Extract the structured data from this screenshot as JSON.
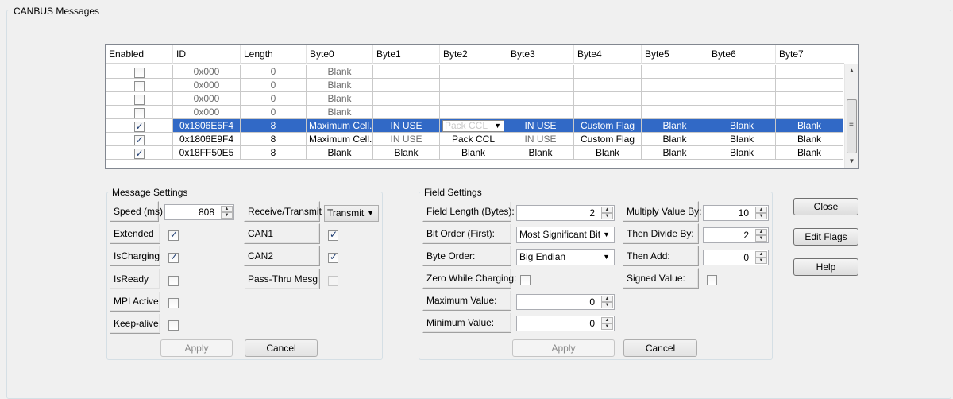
{
  "group_title": "CANBUS Messages",
  "table": {
    "headers": [
      "Enabled",
      "ID",
      "Length",
      "Byte0",
      "Byte1",
      "Byte2",
      "Byte3",
      "Byte4",
      "Byte5",
      "Byte6",
      "Byte7"
    ],
    "rows": [
      {
        "enabled": false,
        "id": "0x000",
        "length": "0",
        "bytes": [
          "Blank",
          "",
          "",
          "",
          "",
          "",
          "",
          ""
        ],
        "state": "dim"
      },
      {
        "enabled": false,
        "id": "0x000",
        "length": "0",
        "bytes": [
          "Blank",
          "",
          "",
          "",
          "",
          "",
          "",
          ""
        ],
        "state": "dim"
      },
      {
        "enabled": false,
        "id": "0x000",
        "length": "0",
        "bytes": [
          "Blank",
          "",
          "",
          "",
          "",
          "",
          "",
          ""
        ],
        "state": "dim"
      },
      {
        "enabled": false,
        "id": "0x000",
        "length": "0",
        "bytes": [
          "Blank",
          "",
          "",
          "",
          "",
          "",
          "",
          ""
        ],
        "state": "dim"
      },
      {
        "enabled": true,
        "id": "0x1806E5F4",
        "length": "8",
        "bytes": [
          "Maximum Cell...",
          "IN USE",
          "Pack CCL",
          "IN USE",
          "Custom Flag",
          "Blank",
          "Blank",
          "Blank"
        ],
        "state": "selected"
      },
      {
        "enabled": true,
        "id": "0x1806E9F4",
        "length": "8",
        "bytes": [
          "Maximum Cell...",
          "IN USE",
          "Pack CCL",
          "IN USE",
          "Custom Flag",
          "Blank",
          "Blank",
          "Blank"
        ],
        "state": "normal"
      },
      {
        "enabled": true,
        "id": "0x18FF50E5",
        "length": "8",
        "bytes": [
          "Blank",
          "Blank",
          "Blank",
          "Blank",
          "Blank",
          "Blank",
          "Blank",
          "Blank"
        ],
        "state": "normal"
      }
    ]
  },
  "message_settings": {
    "title": "Message Settings",
    "speed_label": "Speed (ms)",
    "speed_value": "808",
    "extended_label": "Extended",
    "extended_checked": true,
    "ischarging_label": "IsCharging",
    "ischarging_checked": true,
    "isready_label": "IsReady",
    "isready_checked": false,
    "mpi_active_label": "MPI Active",
    "mpi_active_checked": false,
    "keepalive_label": "Keep-alive",
    "keepalive_checked": false,
    "rx_tx_label": "Receive/Transmit",
    "rx_tx_value": "Transmit",
    "can1_label": "CAN1",
    "can1_checked": true,
    "can2_label": "CAN2",
    "can2_checked": true,
    "passthru_label": "Pass-Thru Mesg",
    "passthru_checked": false,
    "apply_label": "Apply",
    "cancel_label": "Cancel"
  },
  "field_settings": {
    "title": "Field Settings",
    "field_length_label": "Field Length (Bytes):",
    "field_length_value": "2",
    "bit_order_label": "Bit Order (First):",
    "bit_order_value": "Most Significant Bit",
    "byte_order_label": "Byte Order:",
    "byte_order_value": "Big Endian",
    "zero_charging_label": "Zero While Charging:",
    "zero_charging_checked": false,
    "max_value_label": "Maximum Value:",
    "max_value": "0",
    "min_value_label": "Minimum Value:",
    "min_value": "0",
    "multiply_label": "Multiply Value By:",
    "multiply_value": "10",
    "divide_label": "Then Divide By:",
    "divide_value": "2",
    "add_label": "Then Add:",
    "add_value": "0",
    "signed_label": "Signed Value:",
    "signed_checked": false,
    "apply_label": "Apply",
    "cancel_label": "Cancel"
  },
  "side_buttons": {
    "close_label": "Close",
    "edit_flags_label": "Edit Flags",
    "help_label": "Help"
  }
}
